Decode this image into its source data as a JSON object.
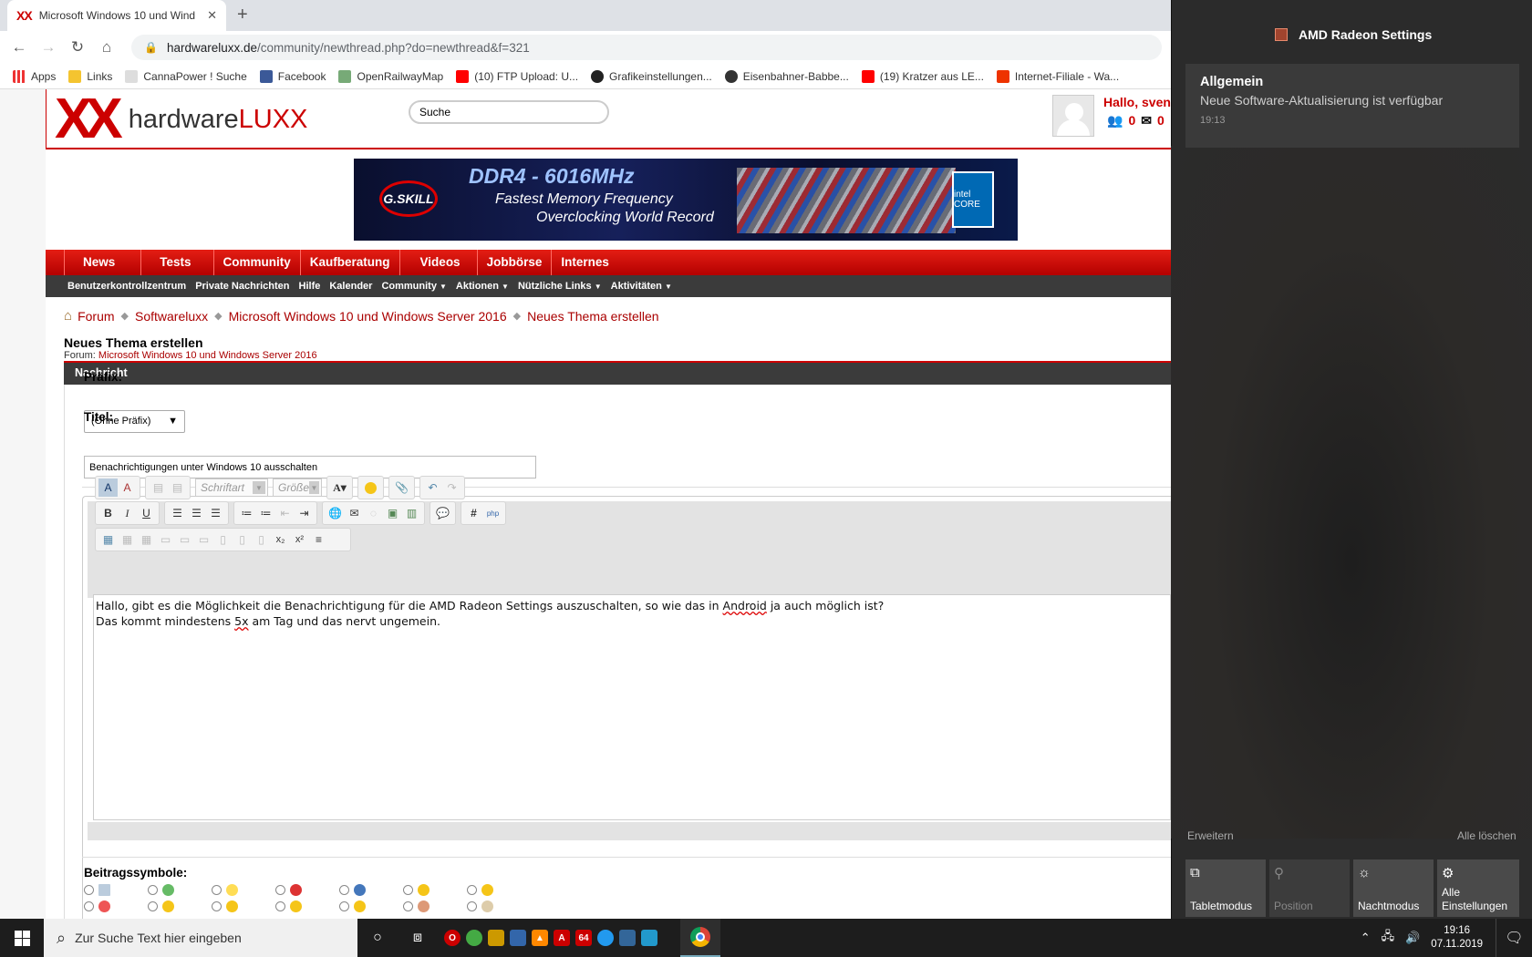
{
  "browser": {
    "tab_title": "Microsoft Windows 10 und Wind",
    "tab_favicon": "XX",
    "url_host": "hardwareluxx.de",
    "url_path": "/community/newthread.php?do=newthread&f=321",
    "bookmarks": [
      "Apps",
      "Links",
      "CannaPower ! Suche",
      "Facebook",
      "OpenRailwayMap",
      "(10) FTP Upload: U...",
      "Grafikeinstellungen...",
      "Eisenbahner-Babbe...",
      "(19) Kratzer aus LE...",
      "Internet-Filiale - Wa..."
    ]
  },
  "site": {
    "logo_xx": "XX",
    "logo_a": "hardware",
    "logo_b": "LUXX",
    "search_placeholder": "Suche",
    "greeting": "Hallo, sven",
    "friends_count": "0",
    "messages_count": "0",
    "banner": {
      "brand": "G.SKILL",
      "line1": "DDR4 - 6016MHz",
      "line2": "Fastest Memory Frequency",
      "line3": "Overclocking World Record",
      "badge": "intel CORE"
    },
    "main_nav": [
      "News",
      "Tests",
      "Community",
      "Kaufberatung",
      "Videos",
      "Jobbörse",
      "Internes"
    ],
    "sub_nav": [
      "Benutzerkontrollzentrum",
      "Private Nachrichten",
      "Hilfe",
      "Kalender",
      "Community",
      "Aktionen",
      "Nützliche Links",
      "Aktivitäten"
    ],
    "breadcrumb": [
      "Forum",
      "Softwareluxx",
      "Microsoft Windows 10 und Windows Server 2016",
      "Neues Thema erstellen"
    ],
    "page_title": "Neues Thema erstellen",
    "forum_label": "Forum:",
    "forum_name": "Microsoft Windows 10 und Windows Server 2016",
    "section_title": "Nachricht",
    "prefix_label": "Präfix:",
    "prefix_value": "(Ohne Präfix)",
    "title_label": "Titel:",
    "title_value": "Benachrichtigungen unter Windows 10 ausschalten",
    "font_select": "Schriftart",
    "size_select": "Größe",
    "message_line1_a": "Hallo, gibt es die Möglichkeit die Benachrichtigung für die AMD Radeon Settings auszuschalten, so wie das in ",
    "message_line1_sp": "Android",
    "message_line1_b": " ja auch möglich ist?",
    "message_line2_a": "Das kommt mindestens ",
    "message_line2_sp": "5x",
    "message_line2_b": " am Tag und das nervt ungemein.",
    "post_icons_label": "Beitragssymbole:"
  },
  "action_center": {
    "app_name": "AMD Radeon Settings",
    "notification_title": "Allgemein",
    "notification_body": "Neue Software-Aktualisierung ist verfügbar",
    "notification_time": "19:13",
    "expand": "Erweitern",
    "clear_all": "Alle löschen",
    "quick_actions": [
      "Tabletmodus",
      "Position",
      "Nachtmodus",
      "Alle Einstellungen"
    ]
  },
  "taskbar": {
    "search_placeholder": "Zur Suche Text hier eingeben",
    "time": "19:16",
    "date": "07.11.2019"
  },
  "colors": {
    "brand_red": "#cc0000",
    "nav_dark": "#3b3b3b",
    "pane_bg": "#2b2b2b"
  }
}
